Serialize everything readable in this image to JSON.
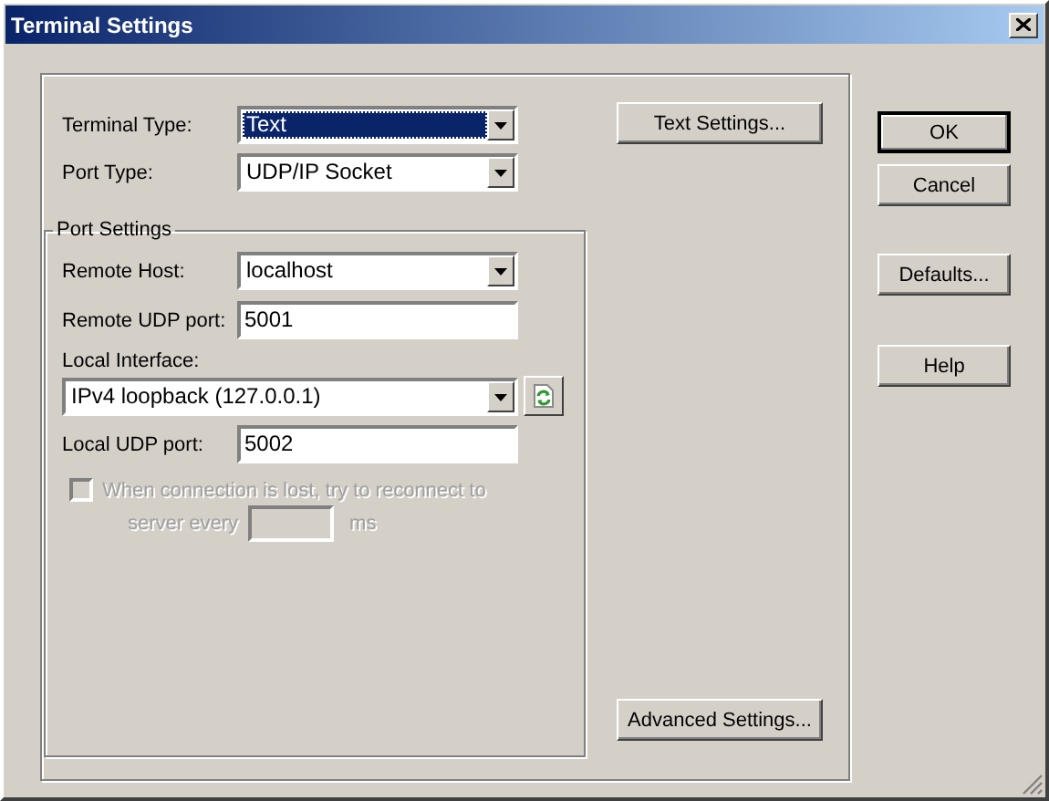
{
  "window": {
    "title": "Terminal Settings"
  },
  "fields": [
    {
      "kind": "combo",
      "label": "Terminal Type:",
      "value": "Text",
      "highlighted": true
    },
    {
      "kind": "combo",
      "label": "Port Type:",
      "value": "UDP/IP Socket",
      "highlighted": false
    }
  ],
  "text_settings_button": "Text Settings...",
  "port_settings": {
    "title": "Port Settings",
    "fields": [
      {
        "kind": "combo",
        "label": "Remote Host:",
        "value": "localhost"
      },
      {
        "kind": "input",
        "label": "Remote UDP port:",
        "value": "5001"
      },
      {
        "kind": "wide_combo",
        "label": "Local Interface:",
        "value": "IPv4 loopback (127.0.0.1)"
      },
      {
        "kind": "input",
        "label": "Local UDP port:",
        "value": "5002"
      }
    ],
    "reconnect": {
      "label": "When connection is lost, try to reconnect to",
      "label_2": "server every",
      "unit": "ms",
      "checked": false,
      "disabled": true
    }
  },
  "advanced_button": "Advanced Settings...",
  "buttons": [
    {
      "label": "OK",
      "default": true
    },
    {
      "label": "Cancel",
      "default": false
    },
    {
      "label": "Defaults...",
      "default": false
    },
    {
      "label": "Help",
      "default": false
    }
  ]
}
